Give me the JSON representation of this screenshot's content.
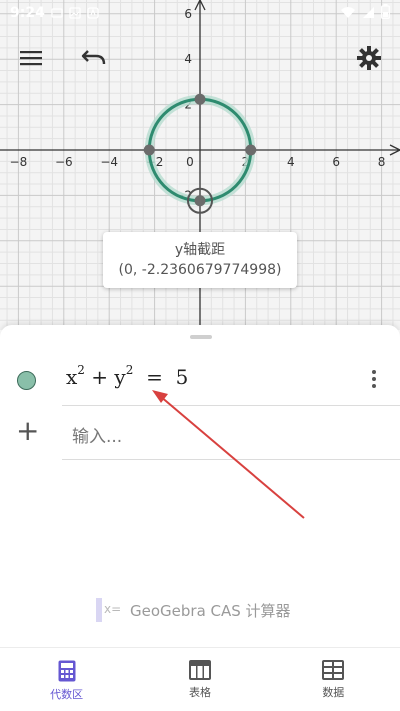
{
  "status_bar": {
    "time": "9:24"
  },
  "graph": {
    "x_ticks": [
      "−8",
      "−6",
      "−4",
      "−2",
      "0",
      "2",
      "4",
      "6",
      "8"
    ],
    "y_ticks_pos": [
      "6",
      "4",
      "2"
    ],
    "y_ticks_neg": [
      "−2"
    ],
    "x_tick_values": [
      -8,
      -6,
      -4,
      -2,
      0,
      2,
      4,
      6,
      8
    ],
    "y_tick_values": [
      6,
      4,
      2,
      -2
    ],
    "circle_radius": 2.2360679774998,
    "points": [
      {
        "x": 0,
        "y": 2.2360679774998
      },
      {
        "x": -2.2360679774998,
        "y": 0
      },
      {
        "x": 2.2360679774998,
        "y": 0
      },
      {
        "x": 0,
        "y": -2.2360679774998
      }
    ],
    "curve_color": "#2e8b6f",
    "point_color": "#6b6b6b"
  },
  "tooltip": {
    "title": "y轴截距",
    "value": "(0, -2.2360679774998)"
  },
  "algebra": {
    "formula_base_x": "x",
    "formula_exp_x": "2",
    "formula_plus": "+",
    "formula_base_y": "y",
    "formula_exp_y": "2",
    "formula_eq": "=",
    "formula_value": "5",
    "input_placeholder": "输入..."
  },
  "cas": {
    "icon_text": "x=",
    "label": "GeoGebra CAS 计算器"
  },
  "nav": {
    "algebra": "代数区",
    "table": "表格",
    "data": "数据"
  },
  "colors": {
    "accent": "#6557d2",
    "annotation_arrow": "#d8413f"
  }
}
